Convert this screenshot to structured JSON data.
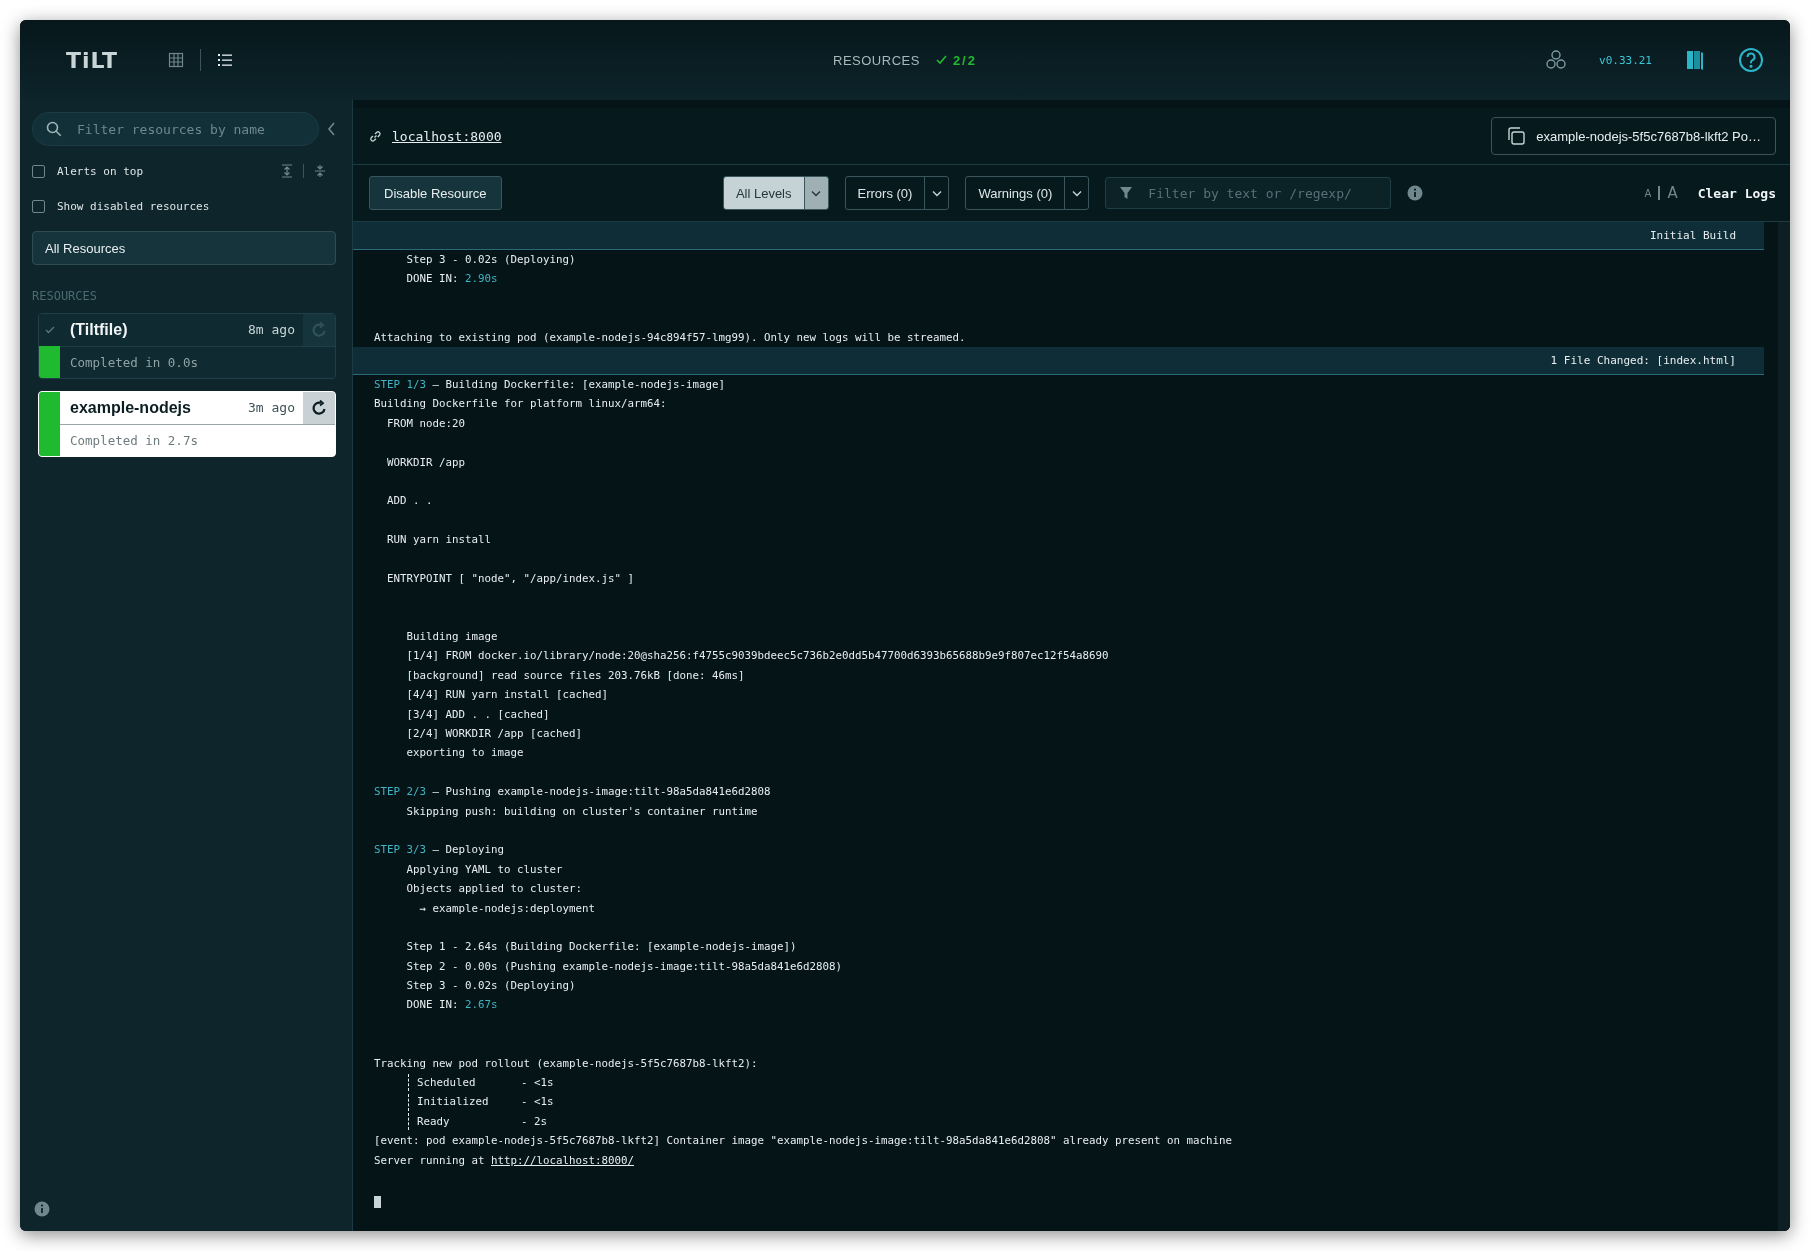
{
  "topbar": {
    "logo": "TiLT",
    "views": [
      {
        "kind": "grid",
        "selected": false
      },
      {
        "kind": "list",
        "selected": true
      }
    ],
    "resources_label": "RESOURCES",
    "resources_count": "2/2",
    "version": "v0.33.21"
  },
  "sidebar": {
    "search": {
      "placeholder": "Filter resources by name"
    },
    "options": [
      {
        "label": "Alerts on top",
        "checked": false
      },
      {
        "label": "Show disabled resources",
        "checked": false
      }
    ],
    "all_resources": "All Resources",
    "section_label": "RESOURCES",
    "resources": [
      {
        "name": "(Tiltfile)",
        "time": "8m ago",
        "status_text": "Completed in 0.0s",
        "selected": false,
        "runtime_ok": false,
        "build_ok": true
      },
      {
        "name": "example-nodejs",
        "time": "3m ago",
        "status_text": "Completed in 2.7s",
        "selected": true,
        "runtime_ok": true,
        "build_ok": true
      }
    ]
  },
  "main": {
    "endpoint": "localhost:8000",
    "pod_button": "example-nodejs-5f5c7687b8-lkft2 Po…",
    "toolbar": {
      "disable_button": "Disable Resource",
      "levels": [
        {
          "label": "All Levels",
          "selected": true
        },
        {
          "label": "Errors (0)",
          "selected": false
        },
        {
          "label": "Warnings (0)",
          "selected": false
        }
      ],
      "filter": {
        "placeholder": "Filter by text or /regexp/"
      },
      "font_size_buttons": [
        {
          "label": "A",
          "kind": "smaller"
        },
        {
          "label": "A",
          "kind": "larger"
        }
      ],
      "clear_button": "Clear Logs"
    },
    "log": [
      {
        "kind": "header",
        "text": "Initial Build"
      },
      {
        "kind": "text",
        "text": "     Step 3 - 0.02s (Deploying)"
      },
      {
        "kind": "done",
        "text": "     DONE IN: ",
        "value": "2.90s"
      },
      {
        "kind": "blank"
      },
      {
        "kind": "blank"
      },
      {
        "kind": "text",
        "text": "Attaching to existing pod (example-nodejs-94c894f57-lmg99). Only new logs will be streamed."
      },
      {
        "kind": "header",
        "text": "1 File Changed: [index.html]"
      },
      {
        "kind": "step",
        "step": "STEP 1/3",
        "text": " — Building Dockerfile: [example-nodejs-image]"
      },
      {
        "kind": "text",
        "text": "Building Dockerfile for platform linux/arm64:"
      },
      {
        "kind": "text",
        "text": "  FROM node:20"
      },
      {
        "kind": "blank"
      },
      {
        "kind": "text",
        "text": "  WORKDIR /app"
      },
      {
        "kind": "blank"
      },
      {
        "kind": "text",
        "text": "  ADD . ."
      },
      {
        "kind": "blank"
      },
      {
        "kind": "text",
        "text": "  RUN yarn install"
      },
      {
        "kind": "blank"
      },
      {
        "kind": "text",
        "text": "  ENTRYPOINT [ \"node\", \"/app/index.js\" ]"
      },
      {
        "kind": "blank"
      },
      {
        "kind": "blank"
      },
      {
        "kind": "text",
        "text": "     Building image"
      },
      {
        "kind": "text",
        "text": "     [1/4] FROM docker.io/library/node:20@sha256:f4755c9039bdeec5c736b2e0dd5b47700d6393b65688b9e9f807ec12f54a8690"
      },
      {
        "kind": "text",
        "text": "     [background] read source files 203.76kB [done: 46ms]"
      },
      {
        "kind": "text",
        "text": "     [4/4] RUN yarn install [cached]"
      },
      {
        "kind": "text",
        "text": "     [3/4] ADD . . [cached]"
      },
      {
        "kind": "text",
        "text": "     [2/4] WORKDIR /app [cached]"
      },
      {
        "kind": "text",
        "text": "     exporting to image"
      },
      {
        "kind": "blank"
      },
      {
        "kind": "step",
        "step": "STEP 2/3",
        "text": " — Pushing example-nodejs-image:tilt-98a5da841e6d2808"
      },
      {
        "kind": "text",
        "text": "     Skipping push: building on cluster's container runtime"
      },
      {
        "kind": "blank"
      },
      {
        "kind": "step",
        "step": "STEP 3/3",
        "text": " — Deploying"
      },
      {
        "kind": "text",
        "text": "     Applying YAML to cluster"
      },
      {
        "kind": "text",
        "text": "     Objects applied to cluster:"
      },
      {
        "kind": "text",
        "text": "       → example-nodejs:deployment"
      },
      {
        "kind": "blank"
      },
      {
        "kind": "text",
        "text": "     Step 1 - 2.64s (Building Dockerfile: [example-nodejs-image])"
      },
      {
        "kind": "text",
        "text": "     Step 2 - 0.00s (Pushing example-nodejs-image:tilt-98a5da841e6d2808)"
      },
      {
        "kind": "text",
        "text": "     Step 3 - 0.02s (Deploying)"
      },
      {
        "kind": "done",
        "text": "     DONE IN: ",
        "value": "2.67s"
      },
      {
        "kind": "blank"
      },
      {
        "kind": "blank"
      },
      {
        "kind": "text",
        "text": "Tracking new pod rollout (example-nodejs-5f5c7687b8-lkft2):"
      },
      {
        "kind": "tree",
        "text": "Scheduled       - <1s"
      },
      {
        "kind": "tree",
        "text": "Initialized     - <1s"
      },
      {
        "kind": "tree",
        "text": "Ready           - 2s"
      },
      {
        "kind": "text",
        "text": "[event: pod example-nodejs-5f5c7687b8-lkft2] Container image \"example-nodejs-image:tilt-98a5da841e6d2808\" already present on machine"
      },
      {
        "kind": "link",
        "text": "Server running at ",
        "value": "http://localhost:8000/"
      },
      {
        "kind": "blank"
      },
      {
        "kind": "cursor"
      }
    ]
  }
}
